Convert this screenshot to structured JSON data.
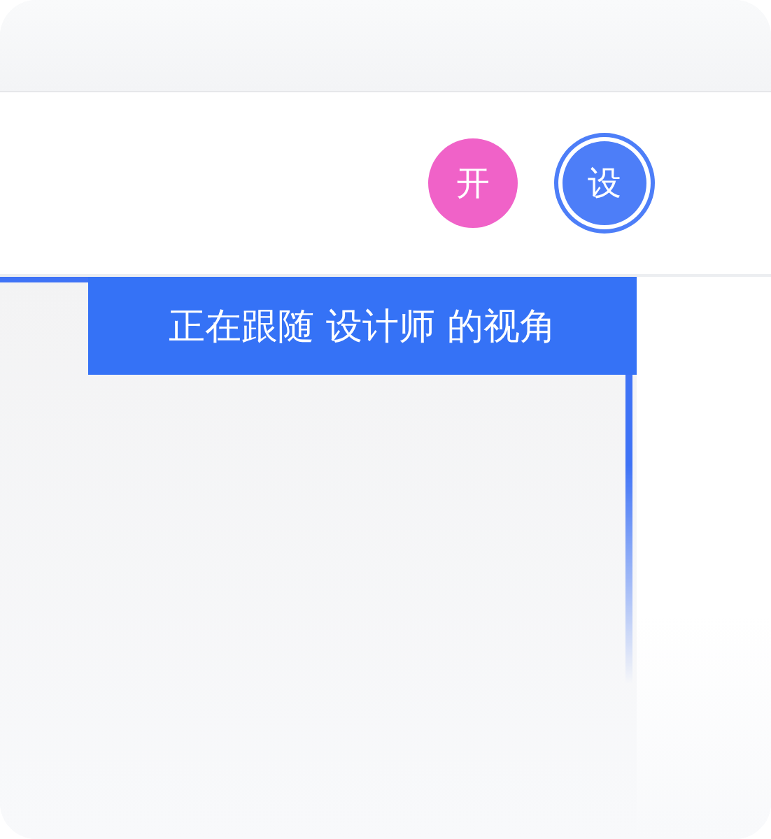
{
  "avatars": [
    {
      "label": "开",
      "color": "#f062c8",
      "selected": false
    },
    {
      "label": "设",
      "color": "#4d7ef8",
      "selected": true
    }
  ],
  "follow_banner": {
    "text": "正在跟随 设计师 的视角"
  }
}
